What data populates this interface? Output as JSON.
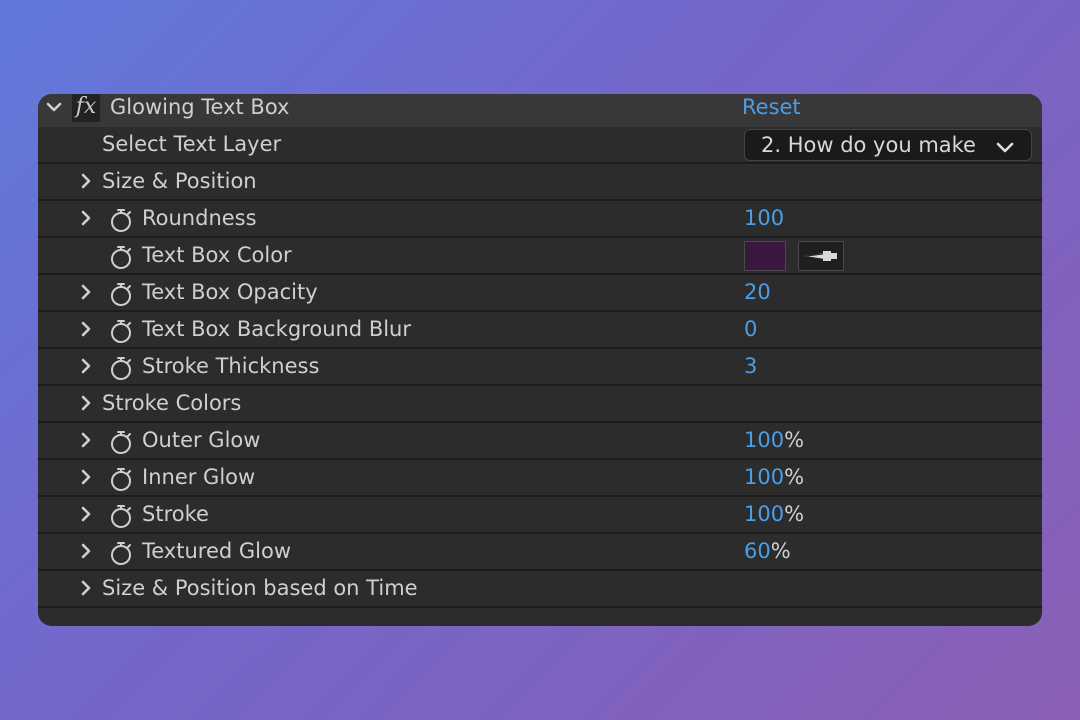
{
  "effect": {
    "name": "Glowing Text Box",
    "fx_icon": "fx-icon",
    "reset_label": "Reset"
  },
  "select_text_layer": {
    "label": "Select Text Layer",
    "value": "2. How do you make"
  },
  "properties": {
    "size_position": {
      "label": "Size & Position"
    },
    "roundness": {
      "label": "Roundness",
      "value": "100"
    },
    "text_box_color": {
      "label": "Text Box Color",
      "color": "#3b1640"
    },
    "text_box_opacity": {
      "label": "Text Box Opacity",
      "value": "20"
    },
    "text_box_background_blur": {
      "label": "Text Box Background Blur",
      "value": "0"
    },
    "stroke_thickness": {
      "label": "Stroke Thickness",
      "value": "3"
    },
    "stroke_colors": {
      "label": "Stroke Colors"
    },
    "outer_glow": {
      "label": "Outer Glow",
      "value": "100",
      "unit": "%"
    },
    "inner_glow": {
      "label": "Inner Glow",
      "value": "100",
      "unit": "%"
    },
    "stroke": {
      "label": "Stroke",
      "value": "100",
      "unit": "%"
    },
    "textured_glow": {
      "label": "Textured Glow",
      "value": "60",
      "unit": "%"
    },
    "size_position_time": {
      "label": "Size & Position based on Time"
    }
  },
  "colors": {
    "accent": "#4a9ee8",
    "panel_row": "#2c2c2c",
    "header_row": "#383838"
  }
}
